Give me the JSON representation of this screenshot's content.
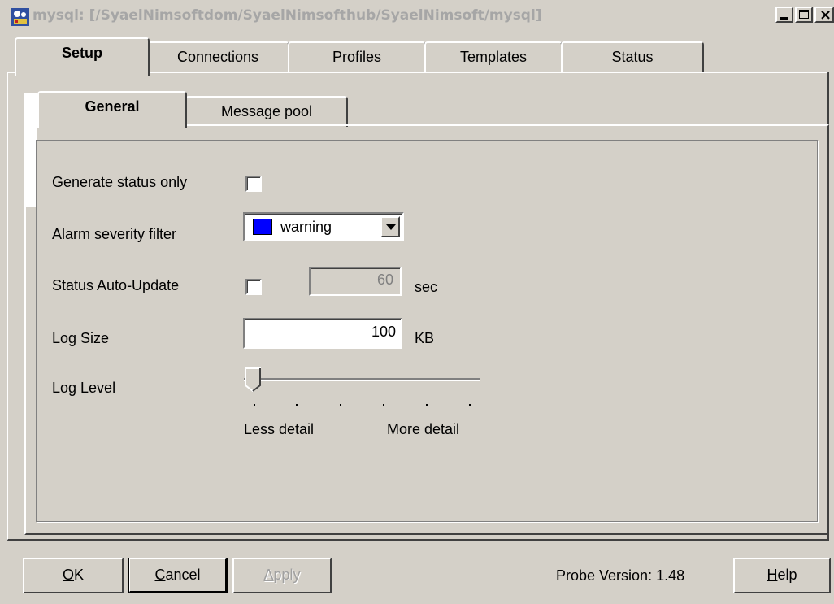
{
  "window": {
    "title": "mysql: [/SyaelNimsoftdom/SyaelNimsofthub/SyaelNimsoft/mysql]"
  },
  "tabs": [
    {
      "label": "Setup",
      "active": true
    },
    {
      "label": "Connections",
      "active": false
    },
    {
      "label": "Profiles",
      "active": false
    },
    {
      "label": "Templates",
      "active": false
    },
    {
      "label": "Status",
      "active": false
    }
  ],
  "subtabs": [
    {
      "label": "General",
      "active": true
    },
    {
      "label": "Message pool",
      "active": false
    }
  ],
  "form": {
    "generate_status_only": {
      "label": "Generate status only",
      "checked": false
    },
    "alarm_severity_filter": {
      "label": "Alarm severity filter",
      "value": "warning",
      "color": "#0000ff"
    },
    "status_auto_update": {
      "label": "Status Auto-Update",
      "checked": false,
      "value": "60",
      "unit": "sec"
    },
    "log_size": {
      "label": "Log Size",
      "value": "100",
      "unit": "KB"
    },
    "log_level": {
      "label": "Log Level",
      "value": 0,
      "min": 0,
      "max": 5,
      "left_label": "Less detail",
      "right_label": "More detail"
    }
  },
  "footer": {
    "ok_pre": "",
    "ok_u": "O",
    "ok_post": "K",
    "cancel_u": "C",
    "cancel_post": "ancel",
    "apply_u": "A",
    "apply_post": "pply",
    "probe_version": "Probe Version: 1.48",
    "help_u": "H",
    "help_post": "elp"
  }
}
